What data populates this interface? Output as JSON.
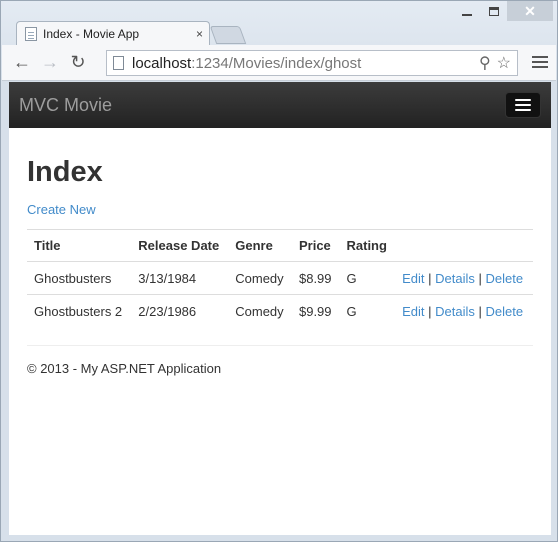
{
  "browser": {
    "tab_title": "Index - Movie App",
    "tab_close": "×",
    "url_host": "localhost",
    "url_rest": ":1234/Movies/index/ghost",
    "back_icon": "←",
    "forward_icon": "→",
    "reload_icon": "↻",
    "search_icon": "⚲",
    "star_icon": "☆",
    "close_glyph": "✕"
  },
  "app": {
    "brand": "MVC Movie",
    "page_title": "Index",
    "create_new": "Create New",
    "table": {
      "headers": [
        "Title",
        "Release Date",
        "Genre",
        "Price",
        "Rating"
      ],
      "rows": [
        {
          "title": "Ghostbusters",
          "release_date": "3/13/1984",
          "genre": "Comedy",
          "price": "$8.99",
          "rating": "G"
        },
        {
          "title": "Ghostbusters 2",
          "release_date": "2/23/1986",
          "genre": "Comedy",
          "price": "$9.99",
          "rating": "G"
        }
      ],
      "actions": {
        "edit": "Edit",
        "details": "Details",
        "delete": "Delete",
        "separator": "|"
      }
    },
    "footer": "© 2013 - My ASP.NET Application"
  }
}
